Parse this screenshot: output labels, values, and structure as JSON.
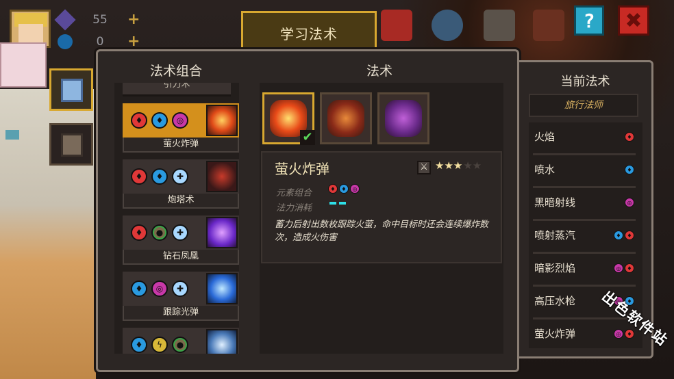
{
  "hud": {
    "gems": "55",
    "coins": "0",
    "plus": "+",
    "help": "?",
    "close": "✖"
  },
  "title_tab": "学习法术",
  "columns": {
    "combo": "法术组合",
    "spell": "法术",
    "current": "当前法术"
  },
  "combos": [
    {
      "label": "引力术",
      "partial": true
    },
    {
      "label": "萤火炸弹",
      "active": true,
      "elements": [
        "fire",
        "water",
        "dark"
      ]
    },
    {
      "label": "炮塔术",
      "active": false,
      "elements": [
        "fire",
        "water",
        "light"
      ]
    },
    {
      "label": "钻石凤凰",
      "active": false,
      "elements": [
        "fire",
        "earth",
        "light"
      ]
    },
    {
      "label": "跟踪光弹",
      "active": false,
      "elements": [
        "water",
        "dark",
        "light"
      ]
    },
    {
      "label": "",
      "active": false,
      "elements": [
        "water",
        "thunder",
        "earth"
      ]
    }
  ],
  "detail": {
    "name": "萤火炸弹",
    "stars_on": "★★★",
    "stars_off": "★★",
    "element_label": "元素组合",
    "mana_label": "法力消耗",
    "description": "蓄力后射出数枚跟踪火萤，命中目标时还会连续爆炸数次，造成火伤害",
    "rating": 3,
    "rating_max": 5
  },
  "current": {
    "class_name": "旅行法师",
    "spells": [
      {
        "name": "火焰",
        "elements": [
          "fire"
        ]
      },
      {
        "name": "喷水",
        "elements": [
          "water"
        ]
      },
      {
        "name": "黑暗射线",
        "elements": [
          "dark"
        ]
      },
      {
        "name": "喷射蒸汽",
        "elements": [
          "water",
          "fire"
        ]
      },
      {
        "name": "暗影烈焰",
        "elements": [
          "dark",
          "fire"
        ]
      },
      {
        "name": "高压水枪",
        "elements": [
          "dark",
          "water"
        ]
      },
      {
        "name": "萤火炸弹",
        "elements": [
          "dark",
          "fire"
        ]
      }
    ]
  },
  "watermark": "出色软件站",
  "colors": {
    "accent_gold": "#d8a830",
    "fire": "#e03838",
    "water": "#2a9ae0",
    "dark": "#c838a8"
  }
}
